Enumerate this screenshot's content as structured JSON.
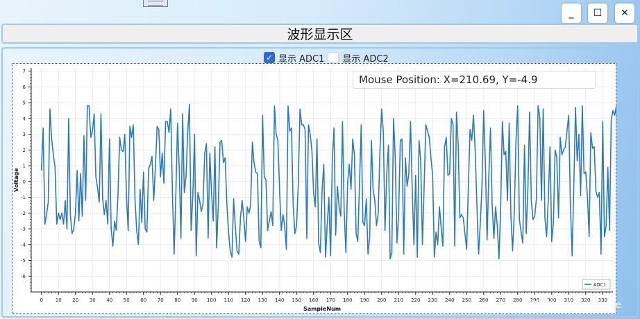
{
  "window": {
    "title": "波形显示区",
    "minimize_label": "_",
    "maximize_label": "☐",
    "close_label": "✕"
  },
  "controls": {
    "show_adc1": {
      "label": "显示 ADC1",
      "checked": true
    },
    "show_adc2": {
      "label": "显示 ADC2",
      "checked": false
    }
  },
  "mouse_position": "Mouse Position: X=210.69, Y=-4.9",
  "watermark": "CSDN @Lemontane",
  "chart_data": {
    "type": "line",
    "xlabel": "SampleNum",
    "ylabel": "Voltage",
    "xlim": [
      -6,
      336
    ],
    "ylim": [
      -7,
      7.2
    ],
    "x_ticks": [
      0,
      10,
      20,
      30,
      40,
      50,
      60,
      70,
      80,
      90,
      100,
      110,
      120,
      130,
      140,
      150,
      160,
      170,
      180,
      190,
      200,
      210,
      220,
      230,
      240,
      250,
      260,
      270,
      280,
      290,
      300,
      310,
      320,
      330
    ],
    "y_ticks": [
      -6,
      -5,
      -4,
      -3,
      -2,
      -1,
      0,
      1,
      2,
      3,
      4,
      5,
      6,
      7
    ],
    "grid": true,
    "legend_position": "bottom-right",
    "colors": {
      "ADC1": "#2e7bb6"
    },
    "series": [
      {
        "name": "ADC1",
        "x_start": 0,
        "x_step": 1,
        "values": [
          0.7,
          3.4,
          -2.7,
          -2.1,
          -1.3,
          4.6,
          2.7,
          1.7,
          0.9,
          -2.7,
          -2.0,
          -2.4,
          -2.0,
          -2.7,
          -1.2,
          -3.0,
          4.0,
          -2.1,
          -3.3,
          -3.0,
          -2.0,
          0.7,
          -2.5,
          0.5,
          -2.2,
          2.9,
          -1.2,
          4.8,
          4.8,
          2.8,
          3.2,
          4.3,
          0.3,
          -0.4,
          -1.3,
          4.3,
          -1.1,
          -2.1,
          -1.2,
          -2.7,
          2.7,
          -3.0,
          -4.1,
          -2.5,
          -3.1,
          -0.8,
          2.8,
          2.0,
          1.9,
          3.0,
          -1.0,
          -3.1,
          3.5,
          2.8,
          3.6,
          -1.1,
          -3.1,
          -4.0,
          -0.5,
          -2.6,
          0.6,
          -3.0,
          -3.2,
          0.8,
          1.1,
          1.6,
          -1.2,
          0.9,
          3.5,
          3.3,
          0.3,
          1.8,
          -0.1,
          3.8,
          3.8,
          3.1,
          4.6,
          -0.7,
          -4.6,
          -0.9,
          3.7,
          0.9,
          -3.6,
          4.3,
          -0.7,
          0.3,
          3.1,
          4.9,
          -3.1,
          -0.9,
          3.0,
          -4.7,
          -0.7,
          -1.2,
          -1.9,
          -1.4,
          1.8,
          2.4,
          -3.6,
          1.8,
          -0.7,
          -2.5,
          2.2,
          -4.2,
          -1.4,
          2.5,
          2.6,
          1.2,
          1.5,
          -1.4,
          -3.2,
          -4.4,
          -4.8,
          -1.1,
          -2.9,
          -4.4,
          -4.6,
          -2.3,
          -1.2,
          -2.4,
          -3.8,
          -1.6,
          -2.0,
          -1.5,
          2.5,
          1.2,
          0.6,
          0.5,
          -3.8,
          -4.2,
          4.2,
          0.3,
          0.1,
          -3.1,
          -2.5,
          -1.9,
          -2.8,
          4.8,
          3.0,
          2.6,
          -0.5,
          -3.1,
          -2.1,
          -2.8,
          -4.3,
          4.8,
          3.2,
          3.4,
          -1.5,
          -3.3,
          -2.8,
          -0.2,
          4.6,
          3.6,
          3.6,
          3.3,
          -3.6,
          3.6,
          3.0,
          2.0,
          -0.7,
          -1.6,
          2.7,
          -3.9,
          -4.5,
          -0.5,
          1.1,
          -4.8,
          -2.8,
          -1.0,
          -4.7,
          1.3,
          3.4,
          -3.4,
          -0.3,
          -1.6,
          -2.2,
          3.8,
          -1.9,
          -4.5,
          -0.1,
          1.1,
          -0.5,
          2.7,
          1.7,
          -3.3,
          -3.8,
          -0.1,
          3.6,
          -2.6,
          -2.8,
          -1.1,
          -4.6,
          -3.5,
          2.6,
          -0.5,
          -1.2,
          -2.8,
          -2.0,
          1.9,
          4.6,
          3.2,
          -3.1,
          0.5,
          2.3,
          -4.9,
          -4.5,
          4.0,
          1.6,
          -3.9,
          -2.1,
          2.6,
          2.7,
          -4.6,
          1.5,
          -0.3,
          0.5,
          3.8,
          -0.5,
          -4.0,
          0.4,
          -4.8,
          2.6,
          1.3,
          -4.0,
          -0.3,
          3.6,
          3.2,
          2.8,
          1.5,
          0.4,
          -4.8,
          -3.2,
          -4.0,
          -1.6,
          -2.9,
          -4.1,
          2.2,
          2.8,
          0.4,
          0.5,
          4.0,
          3.6,
          -4.1,
          4.4,
          2.4,
          -2.3,
          -2.1,
          -2.3,
          -3.3,
          -4.3,
          -0.3,
          3.3,
          2.6,
          4.2,
          2.0,
          -1.4,
          -4.6,
          -2.7,
          -0.3,
          4.5,
          1.2,
          -3.7,
          0.3,
          3.4,
          -1.5,
          -3.6,
          -1.6,
          -2.8,
          -4.9,
          -1.6,
          3.8,
          1.7,
          1.9,
          -1.2,
          3.7,
          -2.1,
          -4.4,
          -2.0,
          2.6,
          4.8,
          -2.4,
          -3.2,
          -3.9,
          2.3,
          -3.3,
          -0.5,
          4.4,
          -1.2,
          -2.4,
          -2.2,
          -1.1,
          4.8,
          4.1,
          -1.2,
          4.6,
          -2.3,
          -3.5,
          -1.1,
          2.2,
          -3.8,
          -2.6,
          2.0,
          1.5,
          -2.3,
          2.8,
          1.7,
          2.0,
          2.2,
          3.2,
          4.2,
          -1.5,
          -4.7,
          -0.3,
          4.7,
          1.3,
          3.0,
          -0.9,
          4.8,
          0.5,
          0.6,
          -0.9,
          -3.5,
          3.1,
          2.1,
          2.2,
          -0.6,
          -1.0,
          -0.7,
          -4.6,
          3.8,
          -3.5,
          -2.8,
          0.9,
          -3.1,
          3.9,
          4.5,
          4.2,
          4.8,
          0.6
        ]
      }
    ]
  }
}
